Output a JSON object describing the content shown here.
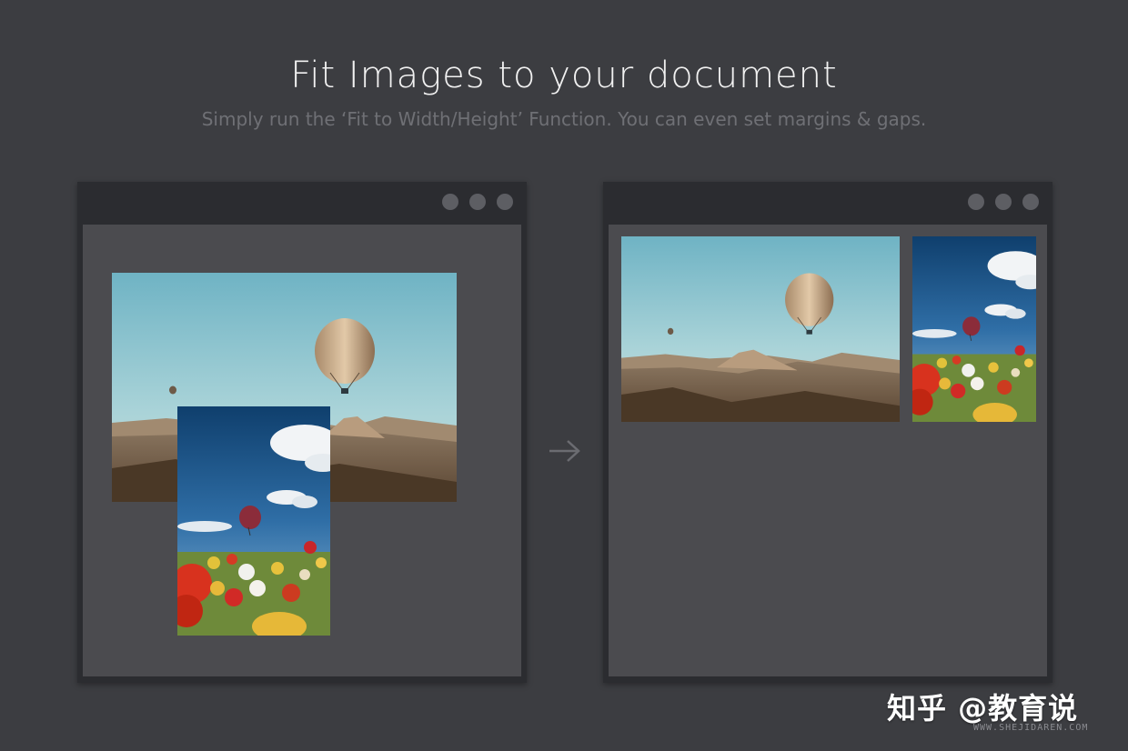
{
  "header": {
    "title": "Fit Images to your document",
    "subtitle": "Simply run the ‘Fit to Width/Height’ Function. You can even set margins & gaps."
  },
  "icons": {
    "arrow": "arrow-right-icon",
    "window_controls": "circle-icon"
  },
  "colors": {
    "background": "#3c3d41",
    "window_frame": "#2b2c30",
    "canvas": "#4b4b4f",
    "title": "#f1f1f1",
    "subtitle": "#6f7075"
  },
  "watermark": {
    "main": "知乎 @教育说",
    "url": "WWW.SHEJIDAREN.COM"
  }
}
